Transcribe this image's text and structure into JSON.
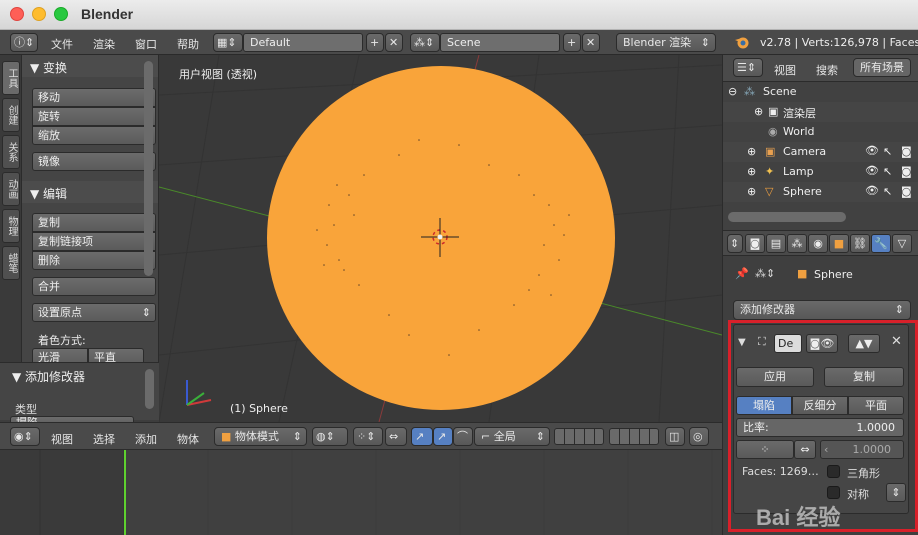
{
  "window": {
    "title": "Blender"
  },
  "info_header": {
    "menus": [
      "文件",
      "渲染",
      "窗口",
      "帮助"
    ],
    "layout": "Default",
    "scene": "Scene",
    "engine": "Blender 渲染",
    "stats": "v2.78 | Verts:126,978 | Faces:1"
  },
  "tool_tabs": [
    "工具",
    "创建",
    "关系",
    "动画",
    "物理",
    "蜡笔"
  ],
  "tool_shelf": {
    "transform": {
      "title": "▼ 变换",
      "buttons": [
        "移动",
        "旋转",
        "缩放",
        "镜像"
      ]
    },
    "edit": {
      "title": "▼ 编辑",
      "buttons": [
        "复制",
        "复制链接项",
        "删除",
        "合并"
      ],
      "origin_select": "设置原点",
      "shading_label": "着色方式:",
      "shading_smooth": "光滑",
      "shading_flat": "平直"
    }
  },
  "operator_panel": {
    "title": "▼ 添加修改器",
    "type_label": "类型",
    "type_value": "塌陷"
  },
  "viewport": {
    "label": "用户视图 (透视)",
    "object_label": "(1) Sphere",
    "sphere_color": "#f9a43a",
    "grid_color": "#333333",
    "x_axis_color": "#8a3a3a",
    "y_axis_color": "#4a8a2a"
  },
  "view_header": {
    "menus": [
      "视图",
      "选择",
      "添加",
      "物体"
    ],
    "mode": "物体模式",
    "pivot": "全局"
  },
  "outliner": {
    "tabs": [
      "视图",
      "搜索",
      "所有场景"
    ],
    "rows": [
      {
        "label": "Scene",
        "icon": "scene-icon"
      },
      {
        "label": "渲染层",
        "icon": "render-layers-icon"
      },
      {
        "label": "World",
        "icon": "world-icon"
      },
      {
        "label": "Camera",
        "icon": "camera-icon"
      },
      {
        "label": "Lamp",
        "icon": "lamp-icon"
      },
      {
        "label": "Sphere",
        "icon": "mesh-icon"
      }
    ]
  },
  "properties": {
    "context_object": "Sphere",
    "add_modifier": "添加修改器",
    "modifier": {
      "name": "De",
      "apply": "应用",
      "copy": "复制",
      "tabs": [
        "塌陷",
        "反细分",
        "平面"
      ],
      "active_tab": "塌陷",
      "ratio_label": "比率:",
      "ratio_value": "1.0000",
      "symmetry_factor": "1.0000",
      "faces": "Faces: 1269…",
      "triangulate": "三角形",
      "symmetry": "对称"
    },
    "accent_color": "#5680c2",
    "highlight_color": "#d8202a"
  },
  "watermark": "Bai 经验"
}
